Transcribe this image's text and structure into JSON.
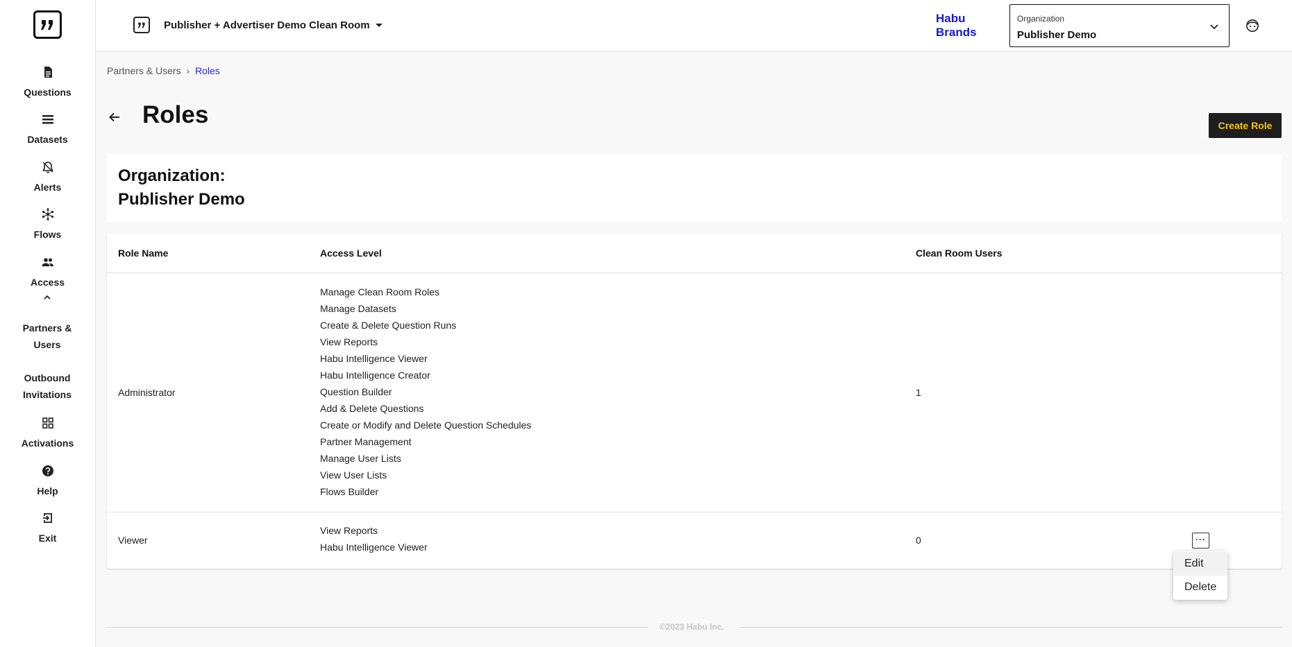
{
  "sidebar": {
    "items": [
      {
        "label": "Questions",
        "icon": "document-icon"
      },
      {
        "label": "Datasets",
        "icon": "list-icon"
      },
      {
        "label": "Alerts",
        "icon": "bell-icon"
      },
      {
        "label": "Flows",
        "icon": "network-icon"
      },
      {
        "label": "Access",
        "icon": "people-icon"
      }
    ],
    "sub_items": [
      {
        "label": "Partners & Users"
      },
      {
        "label": "Outbound Invitations"
      }
    ],
    "bottom_items": [
      {
        "label": "Activations",
        "icon": "grid-icon"
      },
      {
        "label": "Help",
        "icon": "help-icon"
      },
      {
        "label": "Exit",
        "icon": "exit-icon"
      }
    ]
  },
  "header": {
    "clean_room_title": "Publisher + Advertiser Demo Clean Room",
    "brand_line1": "Habu",
    "brand_line2": "Brands",
    "org_select_caption": "Organization",
    "org_select_value": "Publisher Demo"
  },
  "breadcrumb": {
    "parent": "Partners & Users",
    "separator": "›",
    "current": "Roles"
  },
  "page": {
    "title": "Roles",
    "create_button": "Create Role",
    "org_card_line1": "Organization:",
    "org_card_line2": "Publisher Demo"
  },
  "table": {
    "columns": [
      "Role Name",
      "Access Level",
      "Clean Room Users"
    ],
    "rows": [
      {
        "role": "Administrator",
        "access": [
          "Manage Clean Room Roles",
          "Manage Datasets",
          "Create & Delete Question Runs",
          "View Reports",
          "Habu Intelligence Viewer",
          "Habu Intelligence Creator",
          "Question Builder",
          "Add & Delete Questions",
          "Create or Modify and Delete Question Schedules",
          "Partner Management",
          "Manage User Lists",
          "View User Lists",
          "Flows Builder"
        ],
        "users": "1"
      },
      {
        "role": "Viewer",
        "access": [
          "View Reports",
          "Habu Intelligence Viewer"
        ],
        "users": "0"
      }
    ]
  },
  "row_menu": {
    "button": "···",
    "items": [
      "Edit",
      "Delete"
    ]
  },
  "footer": {
    "text": "©2023 Habu Inc."
  },
  "colors": {
    "brand_blue": "#1a19c9",
    "create_btn_bg": "#1e1e1e",
    "create_btn_text": "#f5c518",
    "breadcrumb_current": "#2626c9"
  }
}
